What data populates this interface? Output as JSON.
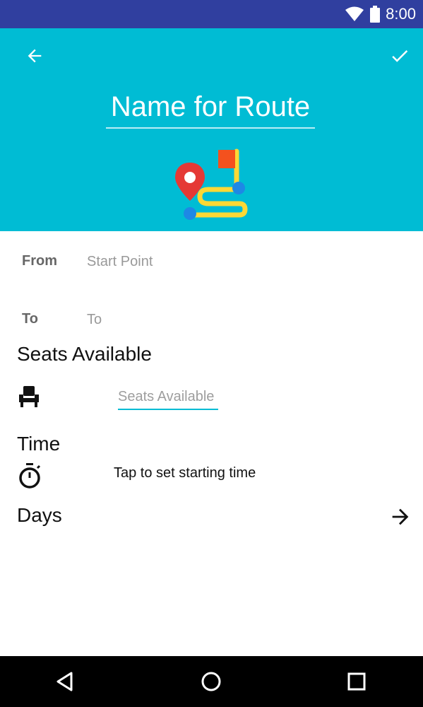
{
  "status_bar": {
    "time": "8:00",
    "color": "#303f9f"
  },
  "header": {
    "color": "#00bcd4",
    "route_name_placeholder": "Name for Route",
    "back_icon": "arrow-back-icon",
    "confirm_icon": "check-icon"
  },
  "form": {
    "from_label": "From",
    "from_placeholder": "Start Point",
    "to_label": "To",
    "to_placeholder": "To",
    "seats_title": "Seats Available",
    "seats_placeholder": "Seats Available",
    "time_title": "Time",
    "time_tap_text": "Tap to set starting time",
    "days_title": "Days"
  },
  "nav_bar": {
    "back": "nav-back-icon",
    "home": "nav-home-icon",
    "recents": "nav-recents-icon"
  }
}
